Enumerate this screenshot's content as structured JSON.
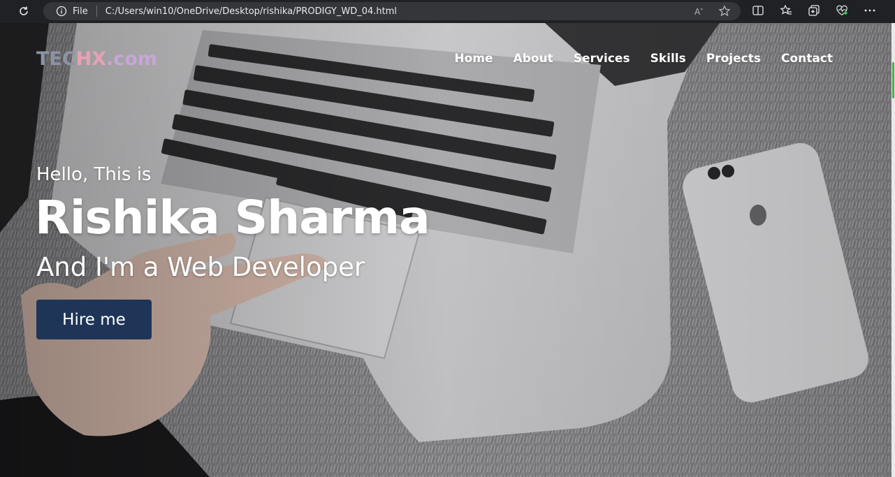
{
  "browser": {
    "scheme_label": "File",
    "url": "C:/Users/win10/OneDrive/Desktop/rishika/PRODIGY_WD_04.html",
    "icons": [
      "reload-icon",
      "info-icon",
      "read-aloud-icon",
      "favorite-star-icon",
      "split-screen-icon",
      "favorites-icon",
      "collections-icon",
      "browser-essentials-icon",
      "more-icon"
    ]
  },
  "site": {
    "logo": {
      "part1": "TEC",
      "part2": "HX",
      "part3": ".com"
    },
    "nav": [
      "Home",
      "About",
      "Services",
      "Skills",
      "Projects",
      "Contact"
    ],
    "hero": {
      "greeting": "Hello, This is",
      "name": "Rishika Sharma",
      "role": "And I'm a Web Developer",
      "cta": "Hire me"
    }
  },
  "colors": {
    "chrome_bg": "#202124",
    "address_bg": "#35363a",
    "button_bg": "#1e3558",
    "logo_primary": "#8d93a4",
    "logo_accent": "#e8a1b3"
  }
}
